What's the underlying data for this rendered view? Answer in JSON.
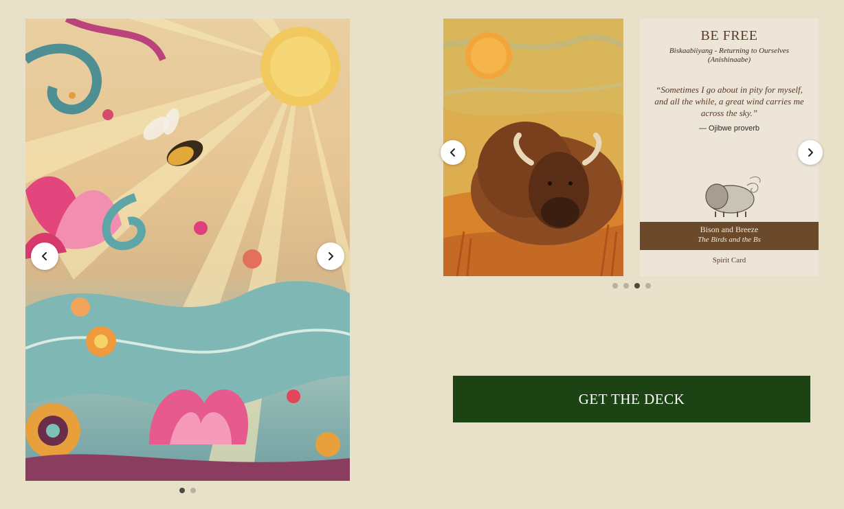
{
  "left_carousel": {
    "image_description_icon": "sun-lotus-bee-illustration",
    "prev_icon": "chevron-left-icon",
    "next_icon": "chevron-right-icon",
    "slide_count": 2,
    "active_slide": 1
  },
  "right_carousel": {
    "prev_icon": "chevron-left-icon",
    "next_icon": "chevron-right-icon",
    "slide_count": 4,
    "active_slide": 3,
    "card_front_icon": "bison-sun-painting",
    "card_back": {
      "title": "BE FREE",
      "subtitle_line1": "Biskaabiiyang - Returning to Ourselves",
      "subtitle_line2": "(Anishinaabe)",
      "quote": "“Sometimes I go about in pity for myself, and all the while, a great wind carries me across the sky.”",
      "attribution": "— Ojibwe proverb",
      "sketch_icon": "bison-sketch-icon",
      "band_name": "Bison and Breeze",
      "band_series": "The Birds and the Bs",
      "card_type": "Spirit Card"
    }
  },
  "cta": {
    "label": "GET THE DECK",
    "color": "#1b4314"
  },
  "colors": {
    "background": "#e8e0c8",
    "card_band": "#6b4a2c"
  }
}
